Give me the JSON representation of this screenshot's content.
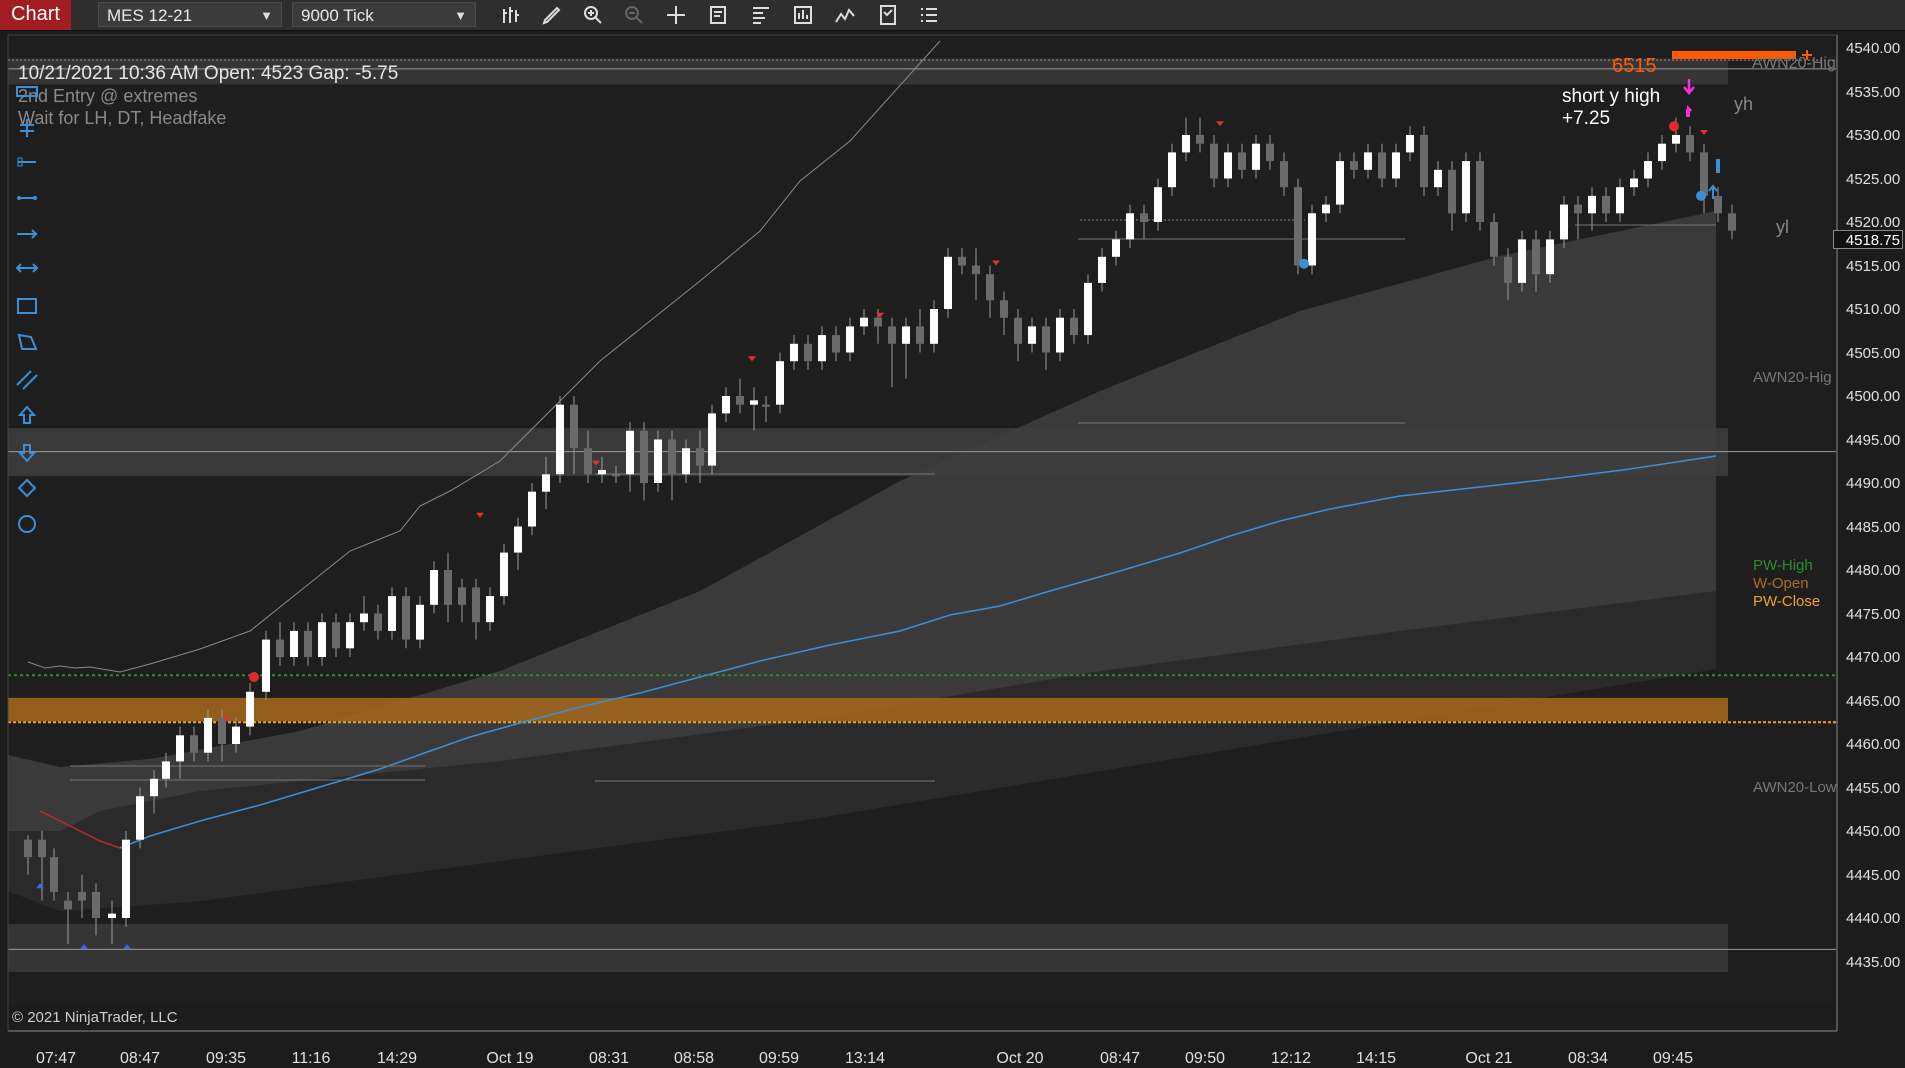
{
  "toolbar": {
    "tab_label": "Chart",
    "instrument": "MES 12-21",
    "interval": "9000 Tick"
  },
  "chart": {
    "header": "10/21/2021 10:36 AM   Open: 4523   Gap: -5.75",
    "notes": [
      "2nd Entry @ extremes",
      "Wait for LH, DT, Headfake"
    ],
    "copyright": "© 2021 NinjaTrader, LLC",
    "last_price": "4518.75",
    "order_qty": "6515",
    "annotation_line1": "short y high",
    "annotation_line2": "+7.25",
    "label_yh": "yh",
    "label_yl": "yl",
    "awn_high_top": "AWN20-Hig",
    "awn_high": "AWN20-Hig",
    "awn_low": "AWN20-Low",
    "pw_high": "PW-High",
    "w_open": "W-Open",
    "pw_close": "PW-Close",
    "y_ticks": [
      "4540.00",
      "4535.00",
      "4530.00",
      "4525.00",
      "4520.00",
      "4515.00",
      "4510.00",
      "4505.00",
      "4500.00",
      "4495.00",
      "4490.00",
      "4485.00",
      "4480.00",
      "4475.00",
      "4470.00",
      "4465.00",
      "4460.00",
      "4455.00",
      "4450.00",
      "4445.00",
      "4440.00",
      "4435.00"
    ],
    "x_ticks": [
      "07:47",
      "08:47",
      "09:35",
      "11:16",
      "14:29",
      "Oct 19",
      "08:31",
      "08:58",
      "09:59",
      "13:14",
      "Oct 20",
      "08:47",
      "09:50",
      "12:12",
      "14:15",
      "Oct 21",
      "08:34",
      "09:45"
    ]
  },
  "colors": {
    "tab_red": "#a11d22",
    "bull": "#ffffff",
    "bear": "#6a6a6a",
    "ema_blue": "#3b8fd9",
    "accent_orange": "#f0a030",
    "order_orange": "#ff5a00",
    "pw_high_green": "#2e8b2e",
    "w_open_brown": "#b36b1f"
  },
  "icons": [
    "bar-chart-icon",
    "pencil-icon",
    "zoom-in-icon",
    "zoom-out-icon",
    "crosshair-icon",
    "data-box-icon",
    "chart-style-icon",
    "chart-trader-icon",
    "indicators-icon",
    "strategy-icon",
    "list-icon"
  ],
  "drawing_tools": [
    "ruler-icon",
    "risk-reward-icon",
    "line-icon",
    "ray-icon",
    "extended-line-icon",
    "arrow-line-icon",
    "rectangle-icon",
    "polygon-icon",
    "parallel-lines-icon",
    "arrow-up-icon",
    "arrow-down-icon",
    "diamond-icon",
    "circle-icon"
  ]
}
